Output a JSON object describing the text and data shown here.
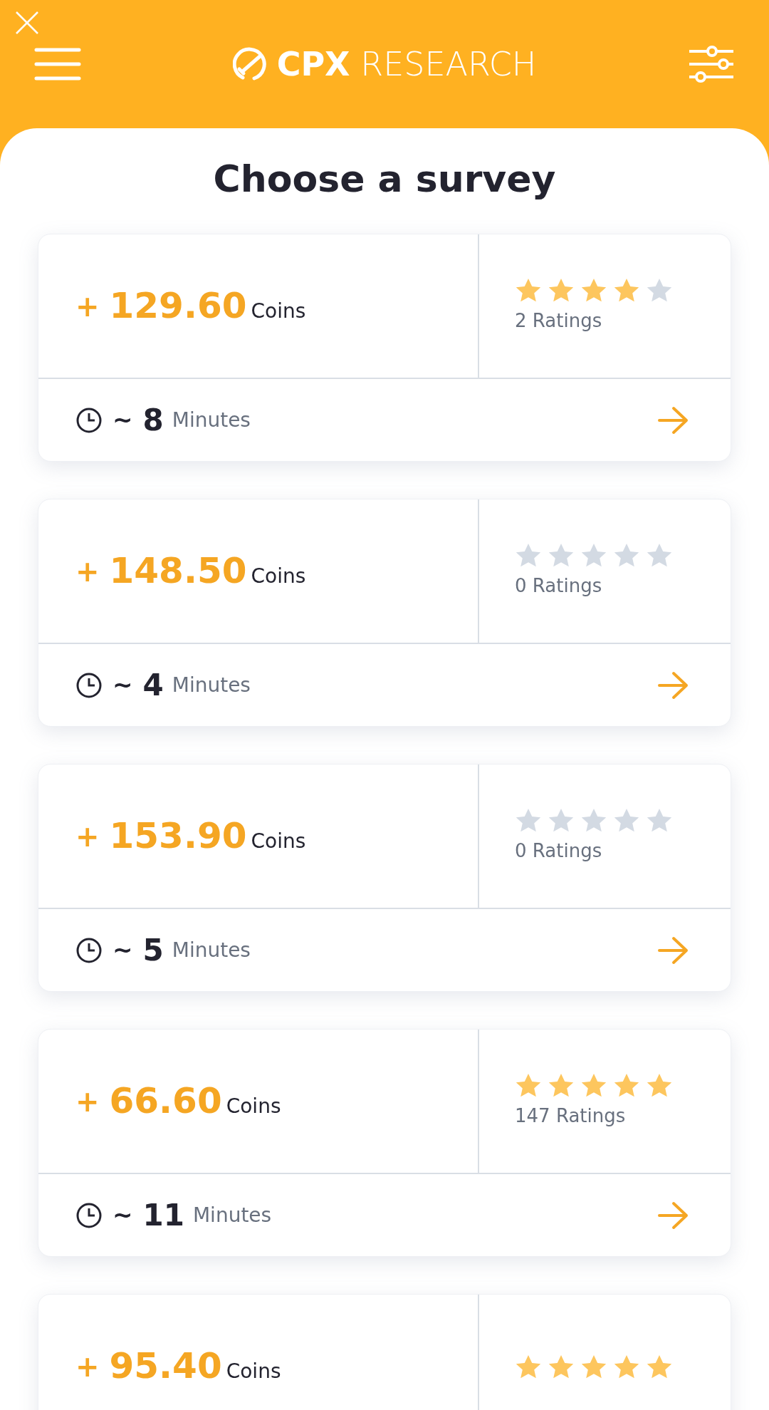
{
  "header": {
    "brand_bold": "CPX",
    "brand_light": "RESEARCH"
  },
  "title": "Choose a survey",
  "surveys": [
    {
      "plus": "+",
      "coins": "129.60",
      "unit": "Coins",
      "stars": 4,
      "ratings": "2 Ratings",
      "tilde": "~",
      "minutes": "8",
      "minutes_unit": "Minutes"
    },
    {
      "plus": "+",
      "coins": "148.50",
      "unit": "Coins",
      "stars": 0,
      "ratings": "0 Ratings",
      "tilde": "~",
      "minutes": "4",
      "minutes_unit": "Minutes"
    },
    {
      "plus": "+",
      "coins": "153.90",
      "unit": "Coins",
      "stars": 0,
      "ratings": "0 Ratings",
      "tilde": "~",
      "minutes": "5",
      "minutes_unit": "Minutes"
    },
    {
      "plus": "+",
      "coins": "66.60",
      "unit": "Coins",
      "stars": 5,
      "ratings": "147 Ratings",
      "tilde": "~",
      "minutes": "11",
      "minutes_unit": "Minutes"
    },
    {
      "plus": "+",
      "coins": "95.40",
      "unit": "Coins",
      "stars": 5
    }
  ]
}
